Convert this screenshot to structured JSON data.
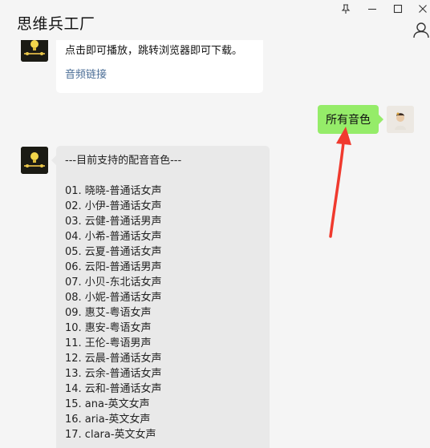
{
  "window": {
    "title": "思维兵工厂",
    "controls": {
      "pin": "pin-icon",
      "minimize": "minimize-icon",
      "maximize": "maximize-icon",
      "close": "close-icon"
    },
    "contact_icon": "person-icon"
  },
  "messages": {
    "top_bubble": {
      "text": "点击即可播放，跳转浏览器即可下载。",
      "link": "音频链接"
    },
    "user_message": {
      "text": "所有音色"
    },
    "voice_list": {
      "header": "---目前支持的配音音色---",
      "items": [
        "01. 晓晓-普通话女声",
        "02. 小伊-普通话女声",
        "03. 云健-普通话男声",
        "04. 小希-普通话女声",
        "05. 云夏-普通话女声",
        "06. 云阳-普通话男声",
        "07. 小贝-东北话女声",
        "08. 小妮-普通话女声",
        "09. 惠艾-粤语女声",
        "10. 惠安-粤语女声",
        "11. 王伦-粤语男声",
        "12. 云晨-普通话女声",
        "13. 云余-普通话女声",
        "14. 云和-普通话女声",
        "15. ana-英文女声",
        "16. aria-英文女声",
        "17. clara-英文女声"
      ]
    }
  },
  "colors": {
    "background": "#f5f5f5",
    "user_bubble": "#95ec69",
    "bot_bubble": "#e9e9e9",
    "link": "#4a6d96",
    "arrow": "#f03a2e"
  }
}
